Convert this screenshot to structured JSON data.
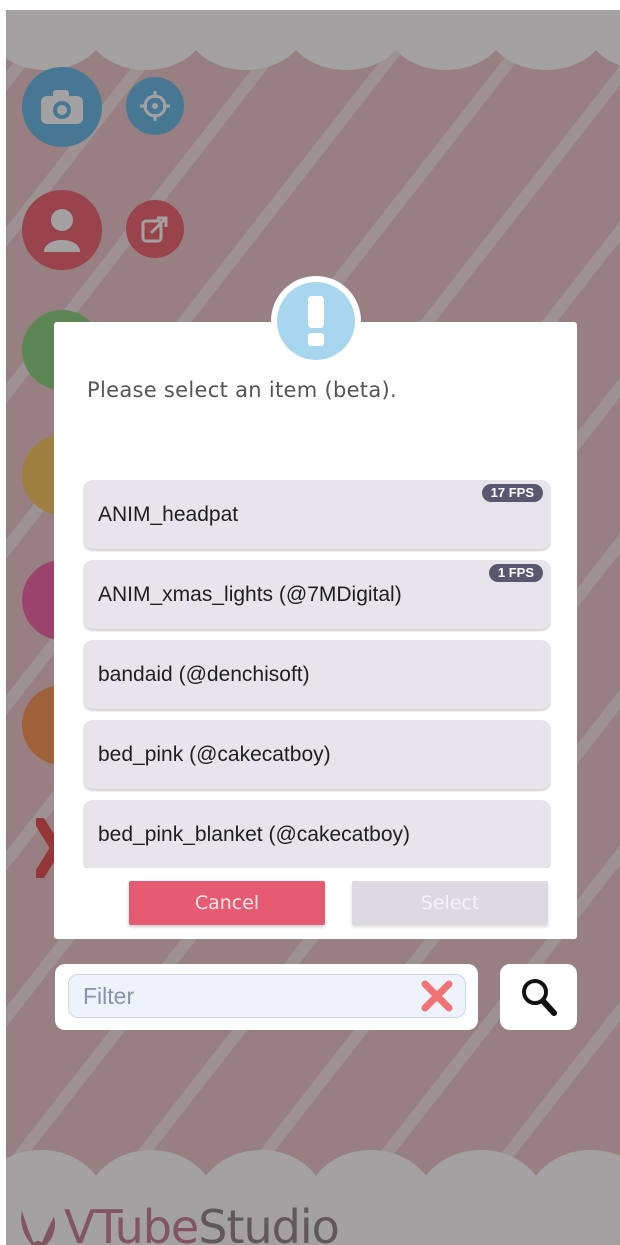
{
  "app": {
    "brand_name": "VTube",
    "brand_suffix": "Studio"
  },
  "dialog": {
    "prompt": "Please select an item (beta).",
    "items": [
      {
        "label": "ANIM_headpat",
        "fps": "17 FPS"
      },
      {
        "label": "ANIM_xmas_lights (@7MDigital)",
        "fps": "1 FPS"
      },
      {
        "label": "bandaid (@denchisoft)"
      },
      {
        "label": "bed_pink (@cakecatboy)"
      },
      {
        "label": "bed_pink_blanket (@cakecatboy)"
      }
    ],
    "cancel_label": "Cancel",
    "select_label": "Select"
  },
  "filter": {
    "placeholder": "Filter",
    "value": ""
  },
  "colors": {
    "cancel": "#e65a72",
    "select_disabled": "#dcd9e3",
    "warning": "#a8d6ee",
    "fps_badge": "#5a5870"
  },
  "icons": {
    "warning": "exclamation-icon",
    "clear": "close-x-icon",
    "search": "magnifier-icon"
  }
}
